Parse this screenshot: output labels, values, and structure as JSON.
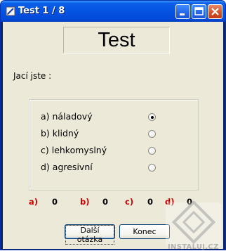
{
  "window": {
    "title": "Test 1 / 8"
  },
  "header": {
    "text": "Test"
  },
  "question": {
    "text": "Jací jste :"
  },
  "options": [
    {
      "label": "a) náladový",
      "selected": true
    },
    {
      "label": "b) klidný",
      "selected": false
    },
    {
      "label": "c) lehkomyslný",
      "selected": false
    },
    {
      "label": "d) agresivní",
      "selected": false
    }
  ],
  "scores": [
    {
      "label": "a)",
      "value": "0"
    },
    {
      "label": "b)",
      "value": "0"
    },
    {
      "label": "c)",
      "value": "0"
    },
    {
      "label": "d)",
      "value": "0"
    }
  ],
  "buttons": {
    "next": "Další otázka",
    "end": "Konec"
  },
  "watermark": {
    "text": "INSTALUJ.CZ"
  },
  "colors": {
    "titlebar": "#0553e3",
    "client_bg": "#ece9d8",
    "score_label": "#cc0000"
  }
}
